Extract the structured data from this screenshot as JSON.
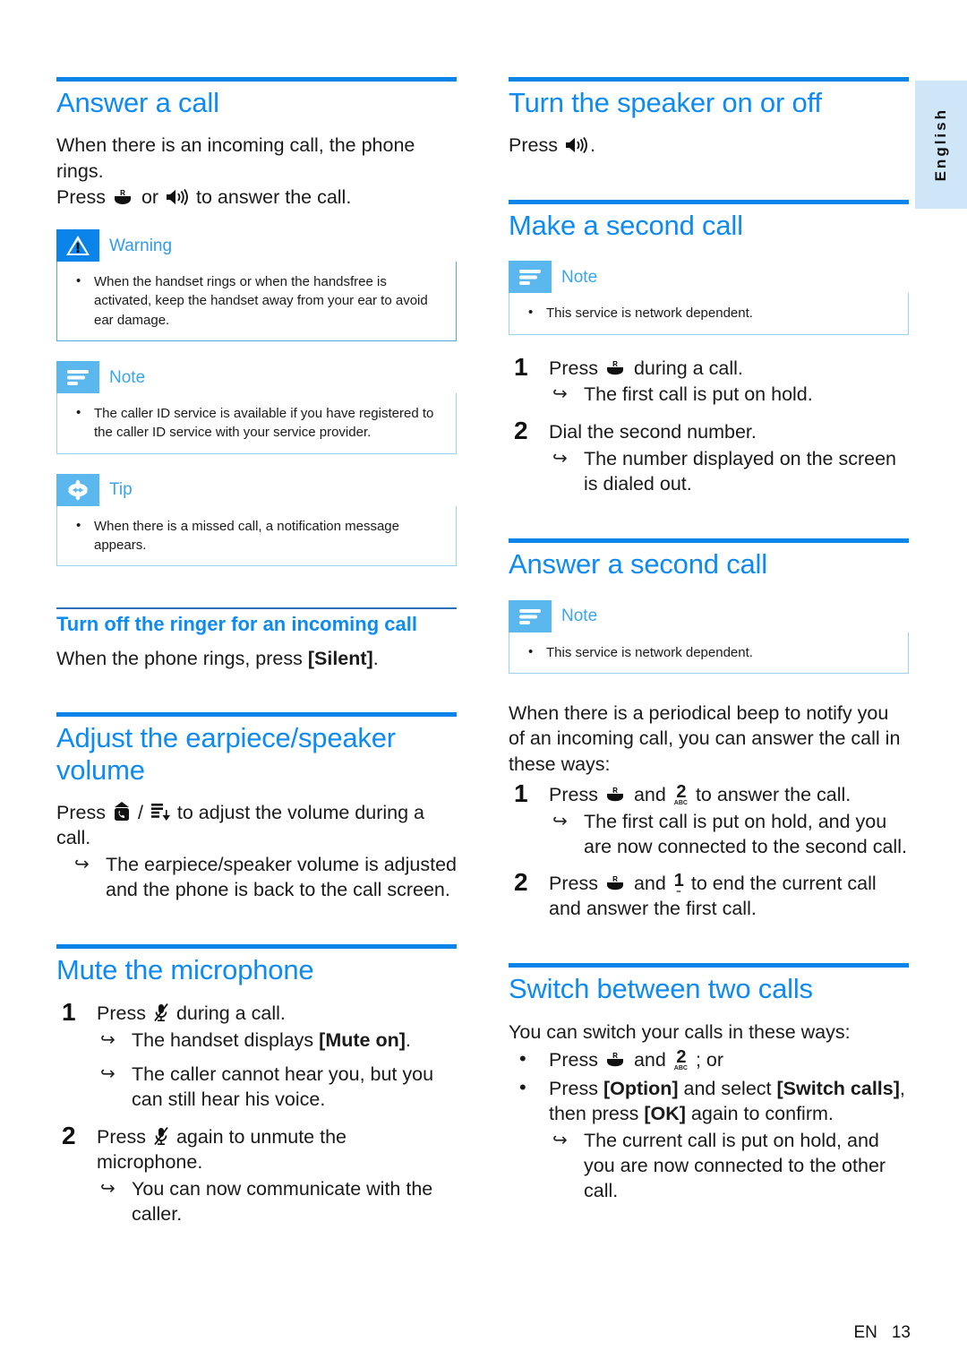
{
  "page": {
    "language_tab": "English",
    "footer_prefix": "EN",
    "footer_page": "13",
    "accent_blue": "#0d8bf2",
    "rule_blue": "#0a84e8",
    "note_blue": "#5bb8ef",
    "box_border": "#9bd2f2"
  },
  "left": {
    "answer_a_call": {
      "heading": "Answer a call",
      "body_line1": "When there is an incoming call, the phone rings.",
      "body_press": "Press",
      "body_or": "or",
      "body_line2_end": "to answer the call.",
      "icon_talk": "talk-key-icon",
      "icon_speaker": "speaker-key-icon"
    },
    "warning": {
      "title": "Warning",
      "icon": "warning-triangle-icon",
      "items": [
        "When the handset rings or when the handsfree is activated, keep the handset away from your ear to avoid ear damage."
      ]
    },
    "note": {
      "title": "Note",
      "icon": "note-lines-icon",
      "items": [
        "The caller ID service is available if you have registered to the caller ID service with your service provider."
      ]
    },
    "tip": {
      "title": "Tip",
      "icon": "tip-asterisk-icon",
      "items": [
        "When there is a missed call, a notification message appears."
      ]
    },
    "turn_off_ringer": {
      "heading": "Turn off the ringer for an incoming call",
      "body_before": "When the phone rings, press ",
      "body_key": "[Silent]",
      "body_after": "."
    },
    "adjust_volume": {
      "heading": "Adjust the earpiece/speaker volume",
      "press": "Press",
      "slash": "/",
      "after_keys": "to adjust the volume during a call.",
      "result": "The earpiece/speaker volume is adjusted and the phone is back to the call screen.",
      "icon_vol_up": "volume-up-key-icon",
      "icon_vol_down": "volume-down-key-icon"
    },
    "mute_microphone": {
      "heading": "Mute the microphone",
      "steps": [
        {
          "press": "Press",
          "after": "during a call.",
          "icon": "mute-mic-key-icon",
          "results": [
            {
              "before": "The handset displays ",
              "bold": "[Mute on]",
              "after": "."
            },
            {
              "before": "The caller cannot hear you, but you can still hear his voice.",
              "bold": "",
              "after": ""
            }
          ]
        },
        {
          "press": "Press",
          "after": "again to unmute the microphone.",
          "icon": "mute-mic-key-icon",
          "results": [
            {
              "before": "You can now communicate with the caller.",
              "bold": "",
              "after": ""
            }
          ]
        }
      ]
    }
  },
  "right": {
    "turn_speaker": {
      "heading": "Turn the speaker on or off",
      "press": "Press",
      "after": ".",
      "icon": "speaker-key-icon"
    },
    "make_second_call": {
      "heading": "Make a second call",
      "note": {
        "title": "Note",
        "icon": "note-lines-icon",
        "items": [
          "This service is network dependent."
        ]
      },
      "steps": [
        {
          "press": "Press",
          "after": "during a call.",
          "icon": "talk-key-icon",
          "results": [
            "The first call is put on hold."
          ]
        },
        {
          "press": "",
          "after": "Dial the second number.",
          "icon": "",
          "results": [
            "The number displayed on the screen is dialed out."
          ]
        }
      ]
    },
    "answer_second_call": {
      "heading": "Answer a second call",
      "note": {
        "title": "Note",
        "icon": "note-lines-icon",
        "items": [
          "This service is network dependent."
        ]
      },
      "intro": "When there is a periodical beep to notify you of an incoming call, you can answer the call in these ways:",
      "steps": [
        {
          "press": "Press",
          "mid": "and",
          "after": "to answer the call.",
          "icon_a": "talk-key-icon",
          "key_digit": "2",
          "key_sub": "ABC",
          "results": [
            "The first call is put on hold, and you are now connected to the second call."
          ]
        },
        {
          "press": "Press",
          "mid": "and",
          "after": "to end the current call and answer the first call.",
          "icon_a": "talk-key-icon",
          "key_digit": "1",
          "key_sub": "",
          "results": []
        }
      ]
    },
    "switch_calls": {
      "heading": "Switch between two calls",
      "intro": "You can switch your calls in these ways:",
      "bullet1": {
        "press": "Press",
        "mid": "and",
        "after": "; or",
        "icon_a": "talk-key-icon",
        "key_digit": "2",
        "key_sub": "ABC"
      },
      "bullet2": {
        "t1": "Press ",
        "b1": "[Option]",
        "t2": " and select ",
        "b2": "[Switch calls]",
        "t3": ", then press ",
        "b3": "[OK]",
        "t4": " again to confirm."
      },
      "result": "The current call is put on hold, and you are now connected to the other call."
    }
  }
}
